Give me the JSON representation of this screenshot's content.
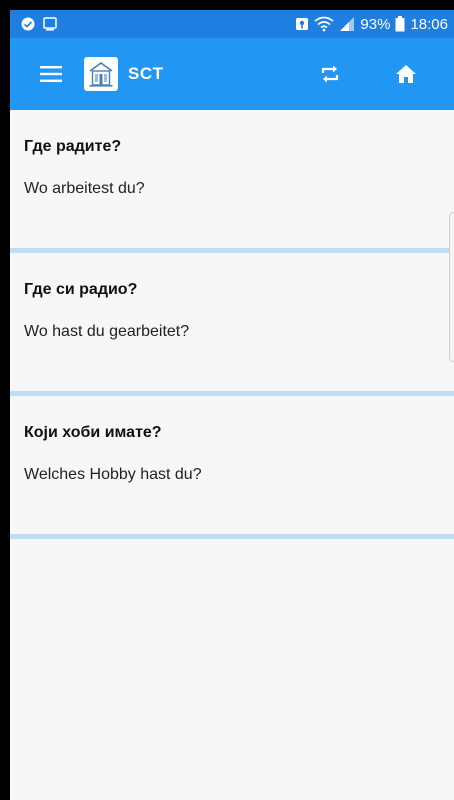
{
  "status_bar": {
    "battery_percent": "93%",
    "time": "18:06",
    "bg_color": "#1f7fe0",
    "icons": [
      "notification-dot-icon",
      "screen-cast-icon",
      "vpn-key-icon",
      "wifi-icon",
      "signal-icon",
      "battery-icon"
    ]
  },
  "app_bar": {
    "title": "SCT",
    "bg_color": "#2196f3",
    "menu_icon": "hamburger-menu-icon",
    "logo_icon": "sct-building-logo",
    "actions": [
      "repeat-icon",
      "home-icon"
    ]
  },
  "phrases": [
    {
      "question": "Где радите?",
      "translation": "Wo arbeitest du?"
    },
    {
      "question": "Где си радио?",
      "translation": "Wo hast du gearbeitet?"
    },
    {
      "question": "Који хоби имате?",
      "translation": "Welches Hobby hast du?"
    }
  ],
  "divider_color": "#bcdff7"
}
